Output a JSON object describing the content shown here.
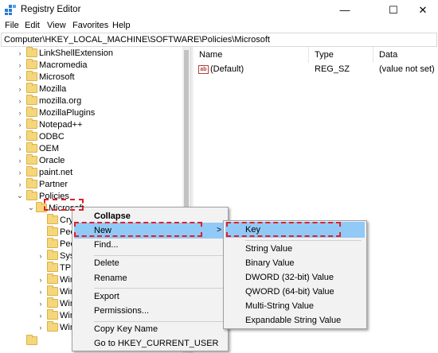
{
  "window": {
    "title": "Registry Editor",
    "minimize_glyph": "—",
    "maximize_glyph": "☐",
    "close_glyph": "✕"
  },
  "menu": [
    "File",
    "Edit",
    "View",
    "Favorites",
    "Help"
  ],
  "address": "Computer\\HKEY_LOCAL_MACHINE\\SOFTWARE\\Policies\\Microsoft",
  "tree": [
    {
      "label": "LinkShellExtension",
      "expanded": false
    },
    {
      "label": "Macromedia",
      "expanded": false
    },
    {
      "label": "Microsoft",
      "expanded": false
    },
    {
      "label": "Mozilla",
      "expanded": false
    },
    {
      "label": "mozilla.org",
      "expanded": false
    },
    {
      "label": "MozillaPlugins",
      "expanded": false
    },
    {
      "label": "Notepad++",
      "expanded": false
    },
    {
      "label": "ODBC",
      "expanded": false
    },
    {
      "label": "OEM",
      "expanded": false
    },
    {
      "label": "Oracle",
      "expanded": false
    },
    {
      "label": "paint.net",
      "expanded": false
    },
    {
      "label": "Partner",
      "expanded": false
    },
    {
      "label": "Policies",
      "expanded": true
    },
    {
      "label": "Microsoft",
      "expanded": true,
      "selected": true
    }
  ],
  "tree_children": [
    {
      "label": "Cry"
    },
    {
      "label": "Pee"
    },
    {
      "label": "Pee"
    },
    {
      "label": "Syst"
    },
    {
      "label": "TPM"
    },
    {
      "label": "Win"
    },
    {
      "label": "Win"
    },
    {
      "label": "Win"
    },
    {
      "label": "Win"
    },
    {
      "label": "Win"
    }
  ],
  "list": {
    "columns": {
      "name": "Name",
      "type": "Type",
      "data": "Data"
    },
    "rows": [
      {
        "name": "(Default)",
        "type": "REG_SZ",
        "data": "(value not set)",
        "icon": "ab"
      }
    ]
  },
  "context_menu": {
    "items": [
      "Collapse",
      "New",
      "Find...",
      "Delete",
      "Rename",
      "Export",
      "Permissions...",
      "Copy Key Name",
      "Go to HKEY_CURRENT_USER"
    ],
    "submenu_arrow": ">"
  },
  "submenu": {
    "items": [
      "Key",
      "String Value",
      "Binary Value",
      "DWORD (32-bit) Value",
      "QWORD (64-bit) Value",
      "Multi-String Value",
      "Expandable String Value"
    ]
  },
  "colors": {
    "highlight": "#91c9f7",
    "annotation": "#e0202a",
    "folder": "#f6d67b"
  }
}
